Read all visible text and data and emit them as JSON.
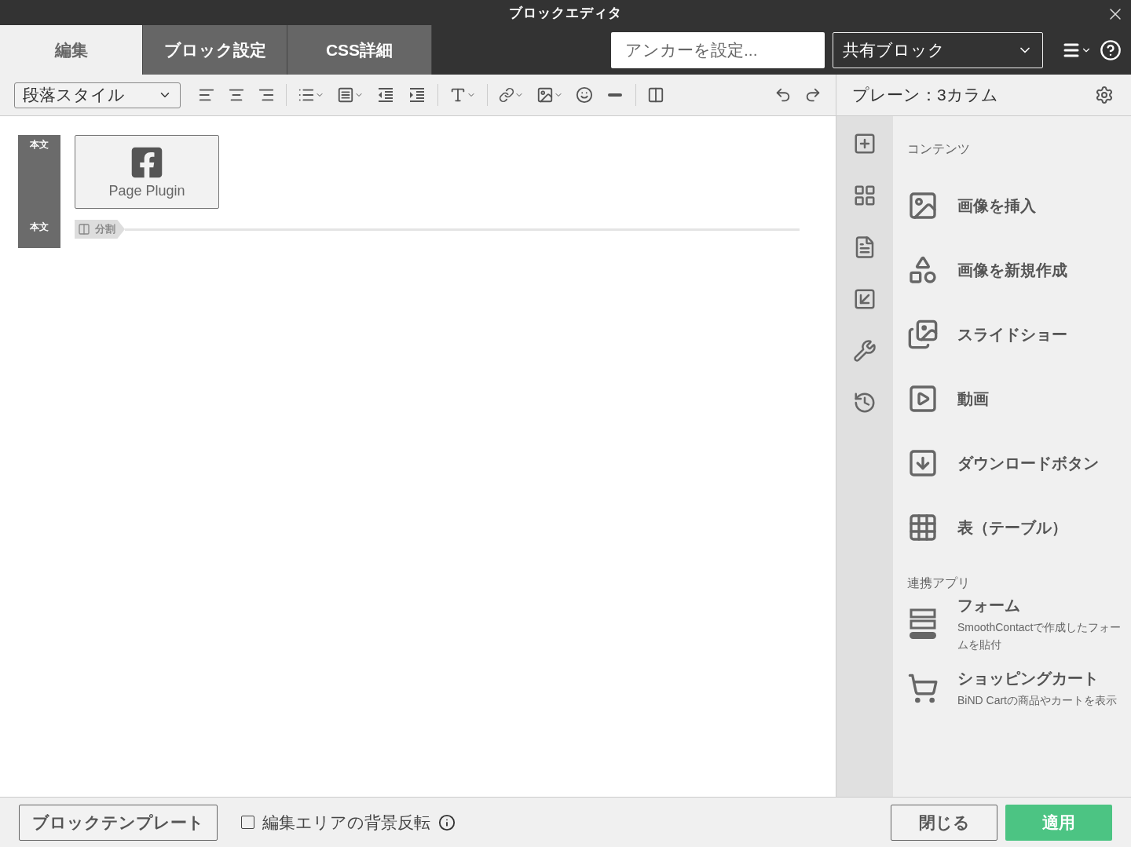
{
  "window": {
    "title": "ブロックエディタ"
  },
  "tabs": [
    {
      "label": "編集",
      "selected": true
    },
    {
      "label": "ブロック設定",
      "selected": false
    },
    {
      "label": "CSS詳細",
      "selected": false
    }
  ],
  "anchor_field": {
    "placeholder": "アンカーを設定..."
  },
  "block_select": {
    "value": "共有ブロック"
  },
  "toolbar": {
    "paragraph_style": "段落スタイル"
  },
  "canvas": {
    "row_labels": [
      "本文",
      "本文"
    ],
    "plugin": {
      "label": "Page Plugin"
    },
    "divider": {
      "label": "分割"
    }
  },
  "panel": {
    "title": "プレーン：3カラム",
    "sections": [
      {
        "heading": "コンテンツ",
        "items": [
          {
            "label": "画像を挿入"
          },
          {
            "label": "画像を新規作成"
          },
          {
            "label": "スライドショー"
          },
          {
            "label": "動画"
          },
          {
            "label": "ダウンロードボタン"
          },
          {
            "label": "表（テーブル）"
          }
        ]
      },
      {
        "heading": "連携アプリ",
        "items": [
          {
            "label": "フォーム",
            "description": "SmoothContactで作成したフォームを貼付"
          },
          {
            "label": "ショッピングカート",
            "description": "BiND Cartの商品やカートを表示"
          }
        ]
      }
    ]
  },
  "footer": {
    "template_button": "ブロックテンプレート",
    "invert_background": {
      "label": "編集エリアの背景反転",
      "checked": false
    },
    "buttons": [
      {
        "label": "閉じる",
        "kind": "secondary"
      },
      {
        "label": "適用",
        "kind": "primary"
      }
    ]
  }
}
